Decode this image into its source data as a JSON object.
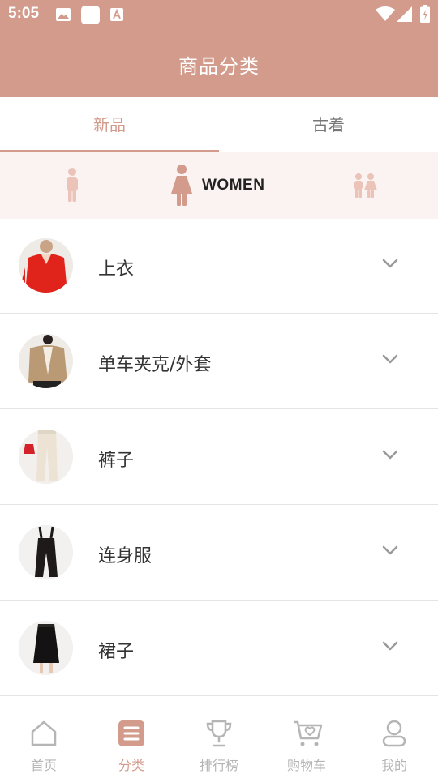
{
  "status_bar": {
    "time": "5:05",
    "left_icons": [
      "image-icon",
      "app-icon",
      "text-notification-icon"
    ],
    "right_icons": [
      "wifi-icon",
      "signal-icon",
      "battery-icon"
    ]
  },
  "header": {
    "title": "商品分类"
  },
  "tabs": [
    {
      "label": "新品",
      "active": true
    },
    {
      "label": "古着",
      "active": false
    }
  ],
  "gender_filter": {
    "options": [
      {
        "icon": "man-icon",
        "label": ""
      },
      {
        "icon": "woman-icon",
        "label": "WOMEN",
        "selected": true
      },
      {
        "icon": "kids-icon",
        "label": ""
      }
    ]
  },
  "categories": [
    {
      "label": "上衣",
      "thumb": "red-blouse-photo"
    },
    {
      "label": "单车夹克/外套",
      "thumb": "tan-jacket-photo"
    },
    {
      "label": "裤子",
      "thumb": "cream-trousers-photo"
    },
    {
      "label": "连身服",
      "thumb": "black-overalls-photo"
    },
    {
      "label": "裙子",
      "thumb": "black-skirt-photo"
    }
  ],
  "bottom_nav": [
    {
      "label": "首页",
      "icon": "home-icon",
      "active": false
    },
    {
      "label": "分类",
      "icon": "category-icon",
      "active": true
    },
    {
      "label": "排行榜",
      "icon": "trophy-icon",
      "active": false
    },
    {
      "label": "购物车",
      "icon": "cart-icon",
      "active": false
    },
    {
      "label": "我的",
      "icon": "profile-icon",
      "active": false
    }
  ],
  "colors": {
    "accent": "#d29b8c",
    "gender_bar_bg": "#faf3f1",
    "inactive": "#b5b5b5"
  }
}
